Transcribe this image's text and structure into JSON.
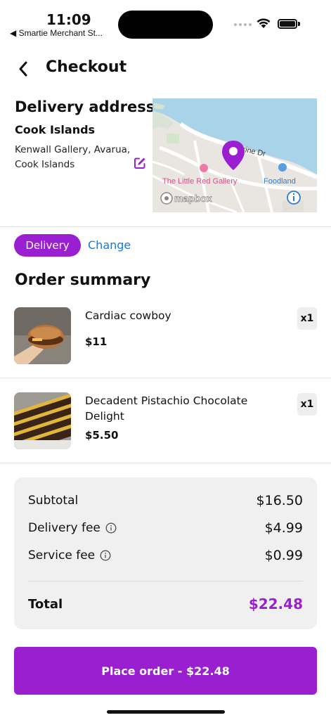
{
  "status_bar": {
    "time": "11:09",
    "back_app": "◀ Smartie Merchant St..."
  },
  "header": {
    "title": "Checkout",
    "back_icon": "chevron-left-icon"
  },
  "address": {
    "heading": "Delivery address",
    "name": "Cook Islands",
    "line1": "Kenwall Gallery, Avarua,",
    "line2": "Cook Islands",
    "edit_icon": "edit-icon"
  },
  "map": {
    "street_label": "rine Dr",
    "poi_1": "The Little Red Gallery",
    "poi_2": "Foodland",
    "logo": "mapbox",
    "pin_color": "#9a1fd1",
    "water_color": "#a9d3e8"
  },
  "delivery_mode": {
    "selected": "Delivery",
    "change_label": "Change"
  },
  "order_summary": {
    "title": "Order summary",
    "items": [
      {
        "name": "Cardiac cowboy",
        "price": "$11",
        "qty": "x1"
      },
      {
        "name": "Decadent Pistachio Chocolate Delight",
        "price": "$5.50",
        "qty": "x1"
      }
    ]
  },
  "totals": {
    "subtotal_label": "Subtotal",
    "subtotal_value": "$16.50",
    "delivery_label": "Delivery fee",
    "delivery_value": "$4.99",
    "service_label": "Service fee",
    "service_value": "$0.99",
    "total_label": "Total",
    "total_value": "$22.48"
  },
  "cta": {
    "place_order": "Place order - $22.48"
  },
  "colors": {
    "accent": "#9a1fd1",
    "link": "#1e78d6"
  }
}
